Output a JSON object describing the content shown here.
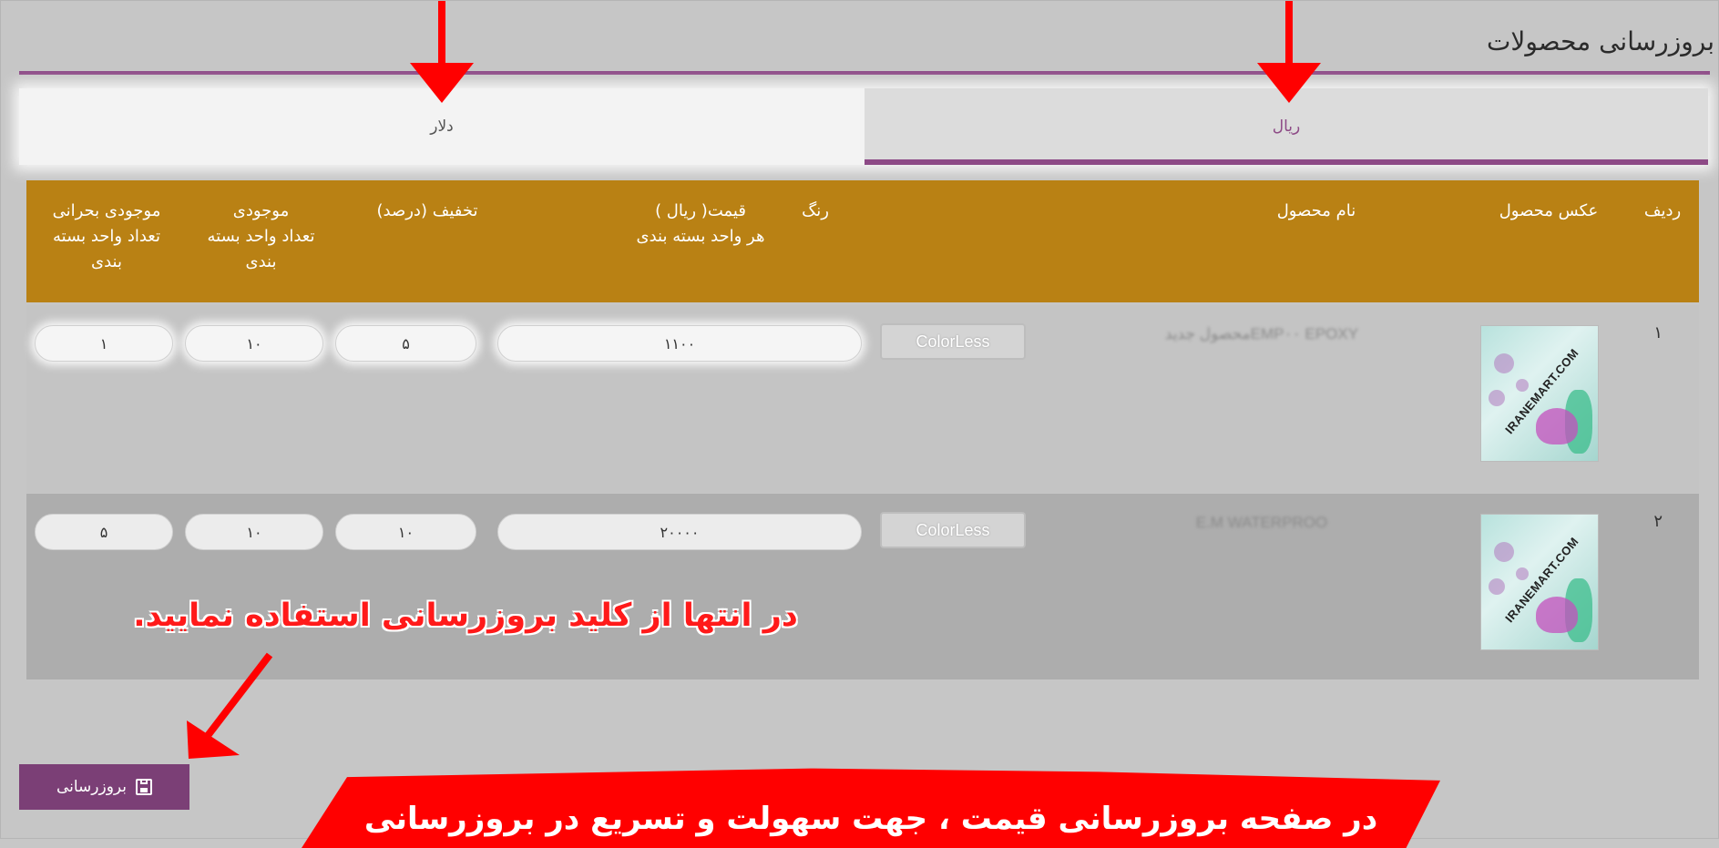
{
  "page": {
    "title": "بروزرسانی محصولات"
  },
  "tabs": [
    {
      "label": "دلار",
      "active": false
    },
    {
      "label": "ریال",
      "active": true
    }
  ],
  "table": {
    "headers": {
      "row": "ردیف",
      "image": "عکس محصول",
      "name": "نام محصول",
      "color": "رنگ",
      "price": "قیمت( ریال )\nهر واحد بسته بندی",
      "discount": "تخفیف (درصد)",
      "stock": "موجودی\nتعداد واحد بسته\nبندی",
      "critical_stock": "موجودی بحرانی\nتعداد واحد بسته\nبندی"
    },
    "rows": [
      {
        "index": "۱",
        "image_watermark": "IRANEMART.COM",
        "name": "محصول جدیدEMP۰۰ EPOXY",
        "color": "ColorLess",
        "price": "۱۱۰۰",
        "discount": "۵",
        "stock": "۱۰",
        "critical_stock": "۱"
      },
      {
        "index": "۲",
        "image_watermark": "IRANEMART.COM",
        "name": "E.M WATERPROO",
        "color": "ColorLess",
        "price": "۲۰۰۰۰",
        "discount": "۱۰",
        "stock": "۱۰",
        "critical_stock": "۵"
      }
    ]
  },
  "update_button": {
    "label": "بروزرسانی",
    "icon": "save-icon"
  },
  "annotations": {
    "hint": "در انتها از کلید بروزرسانی استفاده نمایید.",
    "banner": "در صفحه بروزرسانی قیمت ، جهت سهولت و تسریع در بروزرسانی",
    "color": "#ff0000"
  },
  "colors": {
    "accent": "#8d4a86",
    "header_bg": "#b98114",
    "button_bg": "#7b3f76"
  }
}
